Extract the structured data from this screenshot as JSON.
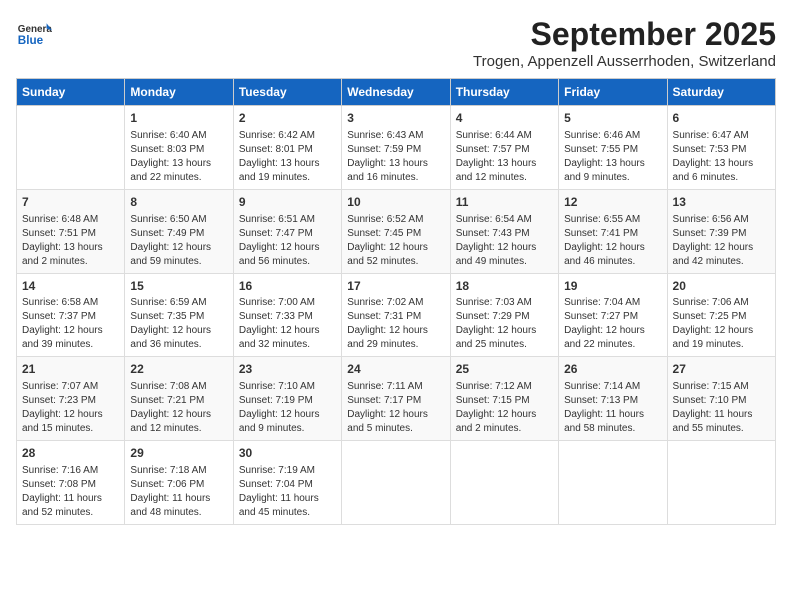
{
  "logo": {
    "general": "General",
    "blue": "Blue"
  },
  "header": {
    "month": "September 2025",
    "location": "Trogen, Appenzell Ausserrhoden, Switzerland"
  },
  "days_of_week": [
    "Sunday",
    "Monday",
    "Tuesday",
    "Wednesday",
    "Thursday",
    "Friday",
    "Saturday"
  ],
  "weeks": [
    [
      {
        "day": "",
        "content": ""
      },
      {
        "day": "1",
        "content": "Sunrise: 6:40 AM\nSunset: 8:03 PM\nDaylight: 13 hours and 22 minutes."
      },
      {
        "day": "2",
        "content": "Sunrise: 6:42 AM\nSunset: 8:01 PM\nDaylight: 13 hours and 19 minutes."
      },
      {
        "day": "3",
        "content": "Sunrise: 6:43 AM\nSunset: 7:59 PM\nDaylight: 13 hours and 16 minutes."
      },
      {
        "day": "4",
        "content": "Sunrise: 6:44 AM\nSunset: 7:57 PM\nDaylight: 13 hours and 12 minutes."
      },
      {
        "day": "5",
        "content": "Sunrise: 6:46 AM\nSunset: 7:55 PM\nDaylight: 13 hours and 9 minutes."
      },
      {
        "day": "6",
        "content": "Sunrise: 6:47 AM\nSunset: 7:53 PM\nDaylight: 13 hours and 6 minutes."
      }
    ],
    [
      {
        "day": "7",
        "content": "Sunrise: 6:48 AM\nSunset: 7:51 PM\nDaylight: 13 hours and 2 minutes."
      },
      {
        "day": "8",
        "content": "Sunrise: 6:50 AM\nSunset: 7:49 PM\nDaylight: 12 hours and 59 minutes."
      },
      {
        "day": "9",
        "content": "Sunrise: 6:51 AM\nSunset: 7:47 PM\nDaylight: 12 hours and 56 minutes."
      },
      {
        "day": "10",
        "content": "Sunrise: 6:52 AM\nSunset: 7:45 PM\nDaylight: 12 hours and 52 minutes."
      },
      {
        "day": "11",
        "content": "Sunrise: 6:54 AM\nSunset: 7:43 PM\nDaylight: 12 hours and 49 minutes."
      },
      {
        "day": "12",
        "content": "Sunrise: 6:55 AM\nSunset: 7:41 PM\nDaylight: 12 hours and 46 minutes."
      },
      {
        "day": "13",
        "content": "Sunrise: 6:56 AM\nSunset: 7:39 PM\nDaylight: 12 hours and 42 minutes."
      }
    ],
    [
      {
        "day": "14",
        "content": "Sunrise: 6:58 AM\nSunset: 7:37 PM\nDaylight: 12 hours and 39 minutes."
      },
      {
        "day": "15",
        "content": "Sunrise: 6:59 AM\nSunset: 7:35 PM\nDaylight: 12 hours and 36 minutes."
      },
      {
        "day": "16",
        "content": "Sunrise: 7:00 AM\nSunset: 7:33 PM\nDaylight: 12 hours and 32 minutes."
      },
      {
        "day": "17",
        "content": "Sunrise: 7:02 AM\nSunset: 7:31 PM\nDaylight: 12 hours and 29 minutes."
      },
      {
        "day": "18",
        "content": "Sunrise: 7:03 AM\nSunset: 7:29 PM\nDaylight: 12 hours and 25 minutes."
      },
      {
        "day": "19",
        "content": "Sunrise: 7:04 AM\nSunset: 7:27 PM\nDaylight: 12 hours and 22 minutes."
      },
      {
        "day": "20",
        "content": "Sunrise: 7:06 AM\nSunset: 7:25 PM\nDaylight: 12 hours and 19 minutes."
      }
    ],
    [
      {
        "day": "21",
        "content": "Sunrise: 7:07 AM\nSunset: 7:23 PM\nDaylight: 12 hours and 15 minutes."
      },
      {
        "day": "22",
        "content": "Sunrise: 7:08 AM\nSunset: 7:21 PM\nDaylight: 12 hours and 12 minutes."
      },
      {
        "day": "23",
        "content": "Sunrise: 7:10 AM\nSunset: 7:19 PM\nDaylight: 12 hours and 9 minutes."
      },
      {
        "day": "24",
        "content": "Sunrise: 7:11 AM\nSunset: 7:17 PM\nDaylight: 12 hours and 5 minutes."
      },
      {
        "day": "25",
        "content": "Sunrise: 7:12 AM\nSunset: 7:15 PM\nDaylight: 12 hours and 2 minutes."
      },
      {
        "day": "26",
        "content": "Sunrise: 7:14 AM\nSunset: 7:13 PM\nDaylight: 11 hours and 58 minutes."
      },
      {
        "day": "27",
        "content": "Sunrise: 7:15 AM\nSunset: 7:10 PM\nDaylight: 11 hours and 55 minutes."
      }
    ],
    [
      {
        "day": "28",
        "content": "Sunrise: 7:16 AM\nSunset: 7:08 PM\nDaylight: 11 hours and 52 minutes."
      },
      {
        "day": "29",
        "content": "Sunrise: 7:18 AM\nSunset: 7:06 PM\nDaylight: 11 hours and 48 minutes."
      },
      {
        "day": "30",
        "content": "Sunrise: 7:19 AM\nSunset: 7:04 PM\nDaylight: 11 hours and 45 minutes."
      },
      {
        "day": "",
        "content": ""
      },
      {
        "day": "",
        "content": ""
      },
      {
        "day": "",
        "content": ""
      },
      {
        "day": "",
        "content": ""
      }
    ]
  ]
}
